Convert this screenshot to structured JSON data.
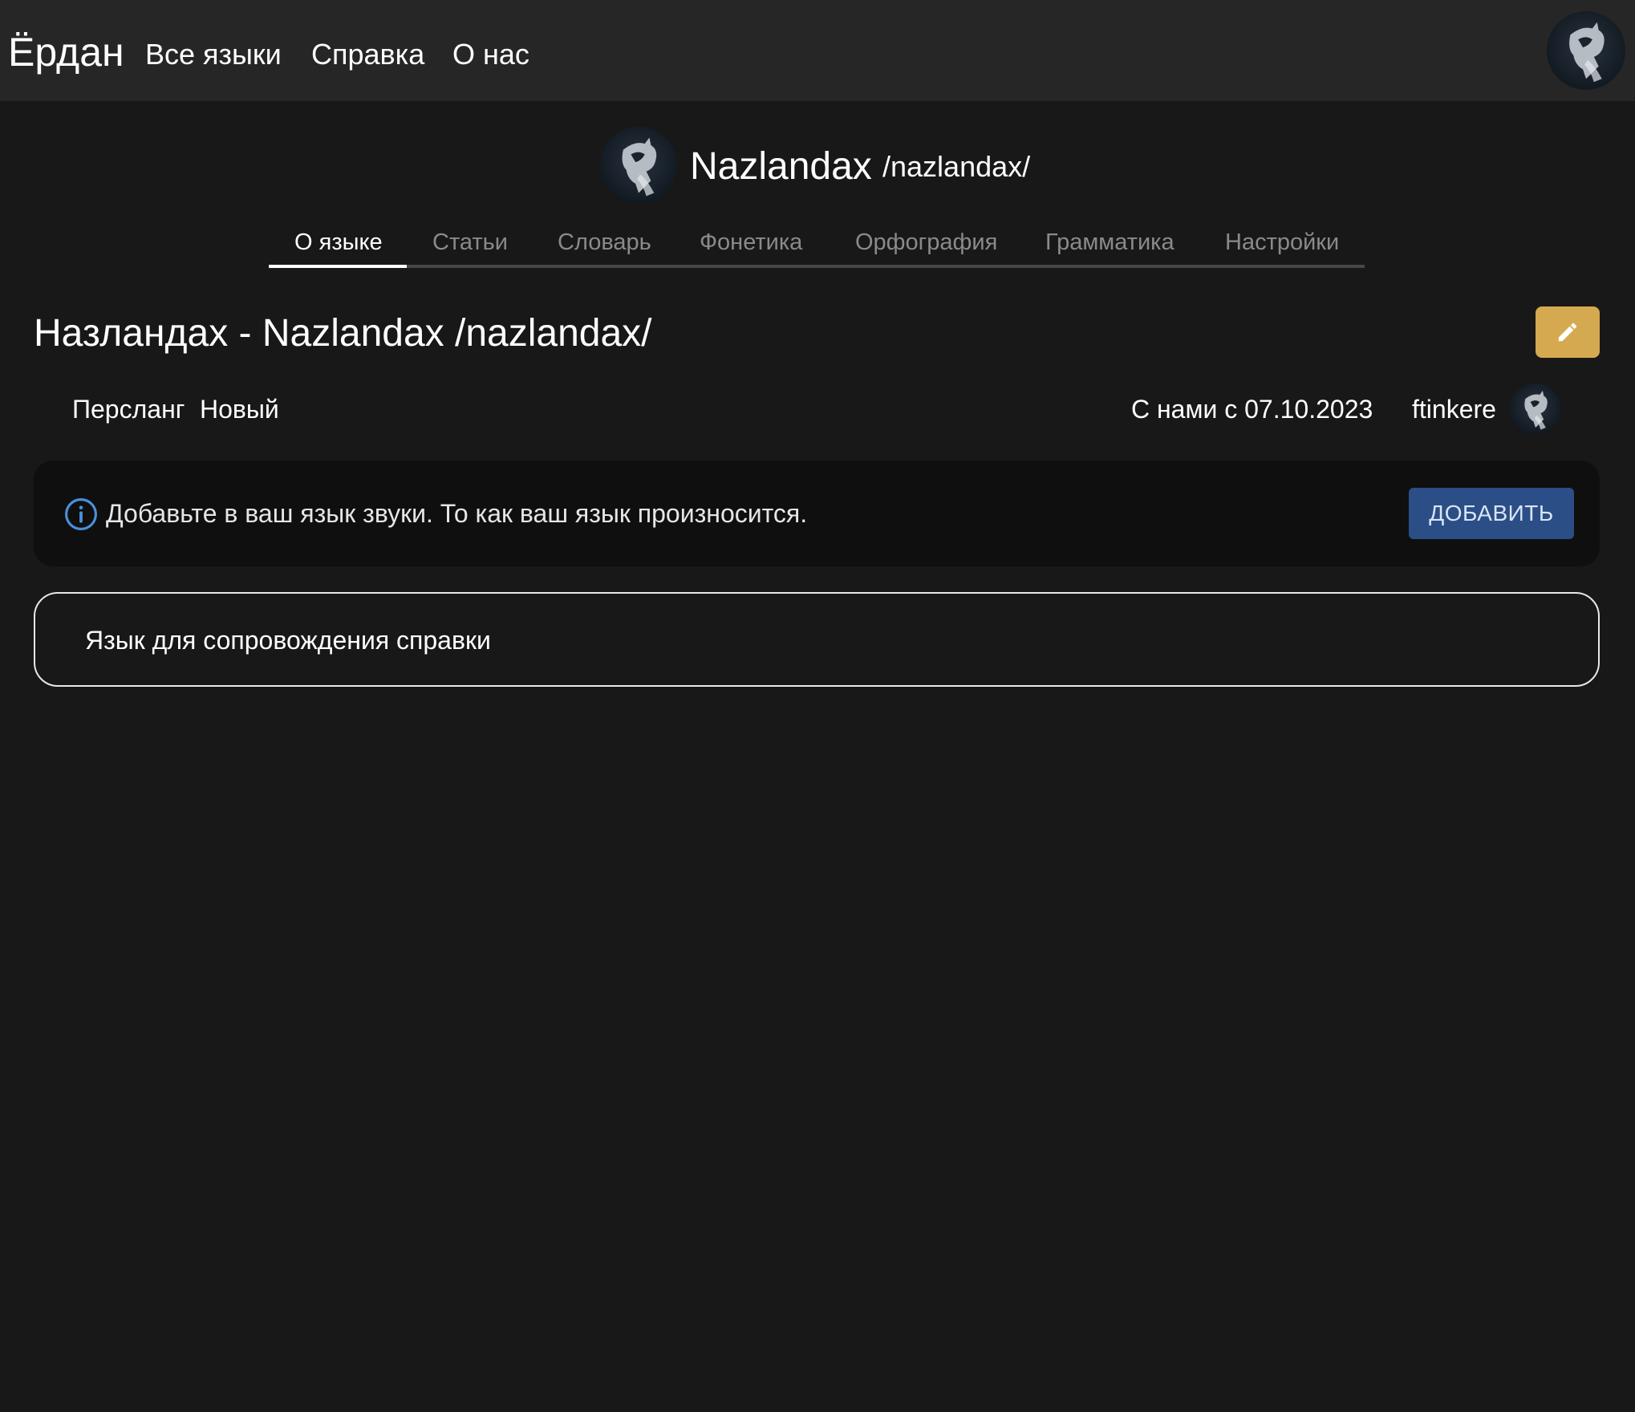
{
  "nav": {
    "brand": "Ёрдан",
    "links": [
      "Все языки",
      "Справка",
      "О нас"
    ]
  },
  "language": {
    "name": "Nazlandax",
    "ipa": "/nazlandax/"
  },
  "tabs": [
    {
      "label": "О языке",
      "active": true
    },
    {
      "label": "Статьи",
      "active": false
    },
    {
      "label": "Словарь",
      "active": false
    },
    {
      "label": "Фонетика",
      "active": false
    },
    {
      "label": "Орфография",
      "active": false
    },
    {
      "label": "Грамматика",
      "active": false
    },
    {
      "label": "Настройки",
      "active": false
    }
  ],
  "page": {
    "title": "Назландах - Nazlandax /nazlandax/",
    "tags": [
      "Перcланг",
      "Новый"
    ],
    "joined": "С нами с 07.10.2023",
    "author": "ftinkere"
  },
  "info_banner": {
    "text": "Добавьте в ваш язык звуки. То как ваш язык произносится.",
    "button_label": "ДОБАВИТЬ"
  },
  "help_panel": {
    "text": "Язык для сопровождения справки"
  },
  "icons": {
    "edit": "pencil-icon",
    "info": "info-icon",
    "avatar": "avatar-image"
  },
  "colors": {
    "background": "#181818",
    "topbar": "#262626",
    "edit_button": "#d4a94f",
    "add_button": "#2b4e86",
    "info_icon": "#4a90d9"
  }
}
